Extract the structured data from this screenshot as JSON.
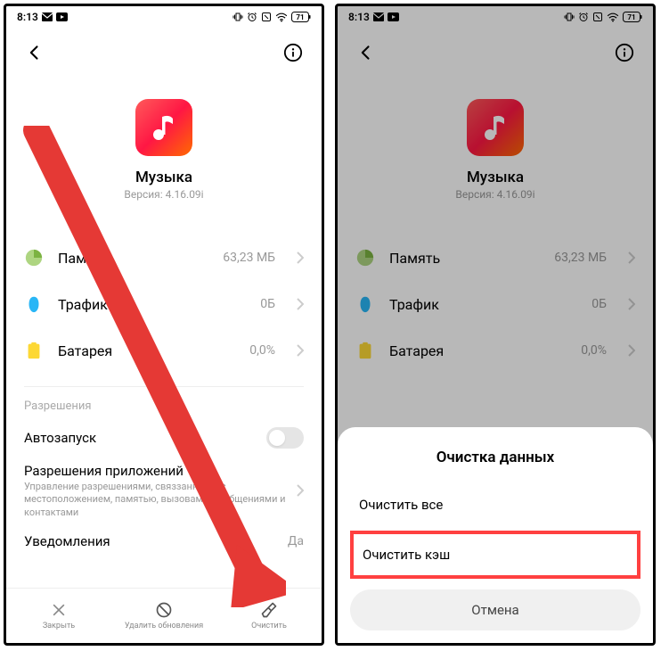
{
  "status": {
    "time": "8:13",
    "battery_text": "71"
  },
  "app": {
    "name": "Музыка",
    "version": "Версия: 4.16.09i"
  },
  "stats": {
    "memory": {
      "label": "Память",
      "value": "63,23 МБ"
    },
    "traffic": {
      "label": "Трафик",
      "value": "0Б"
    },
    "battery": {
      "label": "Батарея",
      "value": "0,0%"
    }
  },
  "permissions_section": "Разрешения",
  "autostart": {
    "label": "Автозапуск"
  },
  "app_permissions": {
    "title": "Разрешения приложений",
    "subtitle": "Управление разрешениями, связзанными с местоположением, памятью, вызовами, сообщениями и контактами"
  },
  "notifications": {
    "label": "Уведомления",
    "value": "Да"
  },
  "bottom_actions": {
    "close": "Закрыть",
    "uninstall_updates": "Удалить обновления",
    "clear": "Очистить"
  },
  "sheet": {
    "title": "Очистка данных",
    "clear_all": "Очистить все",
    "clear_cache": "Очистить кэш",
    "cancel": "Отмена"
  }
}
